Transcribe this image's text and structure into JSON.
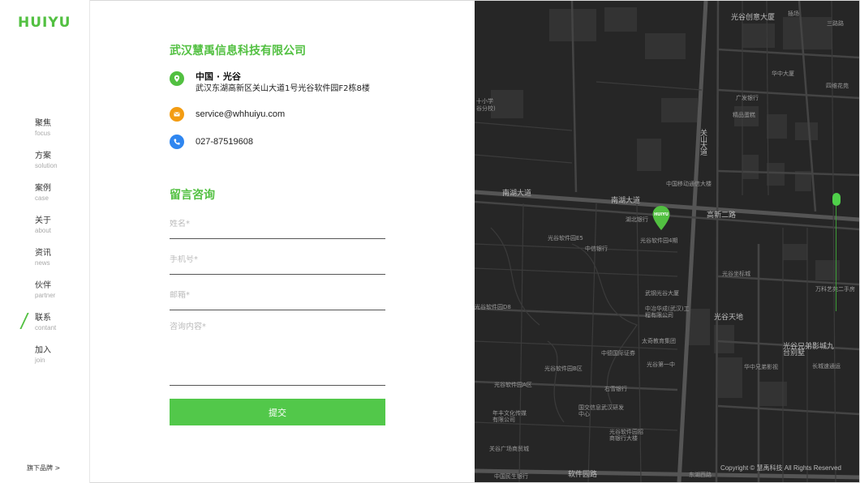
{
  "sidebar": {
    "logo": "HUIYU",
    "items": [
      {
        "zh": "聚焦",
        "en": "focus"
      },
      {
        "zh": "方案",
        "en": "solution"
      },
      {
        "zh": "案例",
        "en": "case"
      },
      {
        "zh": "关于",
        "en": "about"
      },
      {
        "zh": "资讯",
        "en": "news"
      },
      {
        "zh": "伙伴",
        "en": "partner"
      },
      {
        "zh": "联系",
        "en": "contant"
      },
      {
        "zh": "加入",
        "en": "join"
      }
    ],
    "active_index": 6,
    "brand_link": "旗下品牌 >"
  },
  "contact": {
    "company": "武汉慧禹信息科技有限公司",
    "address_title": "中国 · 光谷",
    "address_line": "武汉东湖高新区关山大道1号光谷软件园F2栋8楼",
    "email": "service@whhuiyu.com",
    "phone": "027-87519608"
  },
  "form": {
    "heading": "留言咨询",
    "name_placeholder": "姓名*",
    "phone_placeholder": "手机号*",
    "email_placeholder": "邮箱*",
    "message_placeholder": "咨询内容*",
    "submit_label": "提交"
  },
  "map": {
    "pin_label": "HUIYU",
    "copyright": "Copyright © 慧禹科技 All Rights Reserved",
    "labels": {
      "l1": "光谷创意大厦",
      "l2": "插场",
      "l3": "三路路",
      "l4": "华中大厦",
      "l5": "四维花苑",
      "l6": "广发银行",
      "l7": "十小学",
      "l8": "谷分校)",
      "l9": "关山大道",
      "l10": "南湖大道",
      "l11": "南湖大道",
      "l12": "高新二路",
      "l13": "湖北银行",
      "l14": "光谷软件园4期",
      "l15": "中国移动通信大楼",
      "l16": "光谷软件园E5",
      "l17": "中信银行",
      "l18": "光谷软件园D8",
      "l19": "武钢光谷大厦",
      "l20": "中冶华成(武汉)工程有限公司",
      "l21": "光谷天地",
      "l22": "光谷坐标城",
      "l23": "太奇教育集团",
      "l24": "中德国际证券",
      "l25": "光谷第一中",
      "l26": "华中兄弟影视",
      "l27": "光谷兄弟影城九台别墅",
      "l28": "光谷软件园A区",
      "l29": "光谷软件园B区",
      "l30": "右雪银行",
      "l31": "国交信息武汉研发中心",
      "l32": "年丰文化传媒有限公司",
      "l33": "光谷软件园招商银行大楼",
      "l34": "软件园路",
      "l35": "关谷广场商贸城",
      "l36": "中国民生银行",
      "l37": "东湖西路",
      "l38": "万科艺苑二手房",
      "l39": "精品蛋糕",
      "l40": "长城速通运"
    }
  }
}
